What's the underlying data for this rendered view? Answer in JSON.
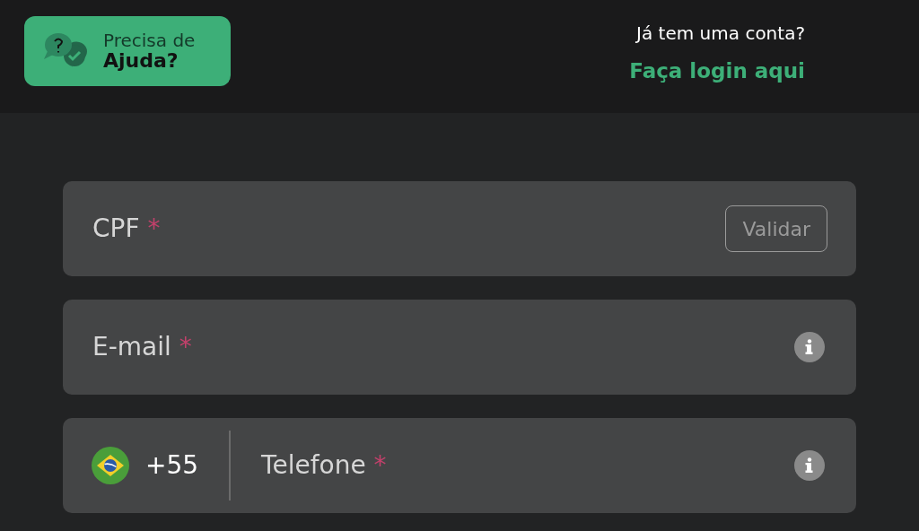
{
  "help_button": {
    "line_1": "Precisa de",
    "line_2": "Ajuda?"
  },
  "login_prompt": {
    "question": "Já tem uma conta?",
    "link": "Faça login aqui"
  },
  "fields": [
    {
      "kind": "action",
      "label": "CPF",
      "required_mark": "*",
      "action": "Validar"
    },
    {
      "kind": "info",
      "label": "E-mail",
      "required_mark": "*"
    },
    {
      "kind": "phone",
      "label": "Telefone",
      "required_mark": "*",
      "country_code": "+55"
    }
  ]
}
